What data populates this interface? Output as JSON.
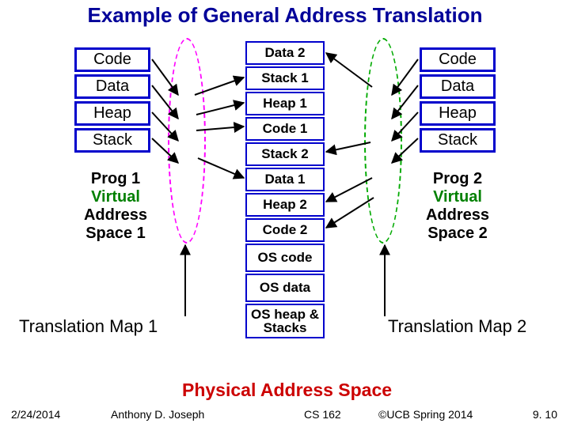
{
  "title": "Example of General Address Translation",
  "prog1": {
    "segments": [
      "Code",
      "Data",
      "Heap",
      "Stack"
    ],
    "caption_prog": "Prog 1",
    "caption_virtual": "Virtual",
    "caption_addr": "Address",
    "caption_space": "Space 1"
  },
  "prog2": {
    "segments": [
      "Code",
      "Data",
      "Heap",
      "Stack"
    ],
    "caption_prog": "Prog 2",
    "caption_virtual": "Virtual",
    "caption_addr": "Address",
    "caption_space": "Space 2"
  },
  "physical": {
    "segments": [
      "Data 2",
      "Stack 1",
      "Heap 1",
      "Code 1",
      "Stack 2",
      "Data 1",
      "Heap 2",
      "Code 2",
      "OS code",
      "OS data",
      "OS heap & Stacks"
    ],
    "label": "Physical Address Space"
  },
  "tmap1": "Translation Map 1",
  "tmap2": "Translation Map 2",
  "footer": {
    "date": "2/24/2014",
    "author": "Anthony D. Joseph",
    "course": "CS 162",
    "copyright": "©UCB Spring 2014",
    "slide": "9. 10"
  }
}
